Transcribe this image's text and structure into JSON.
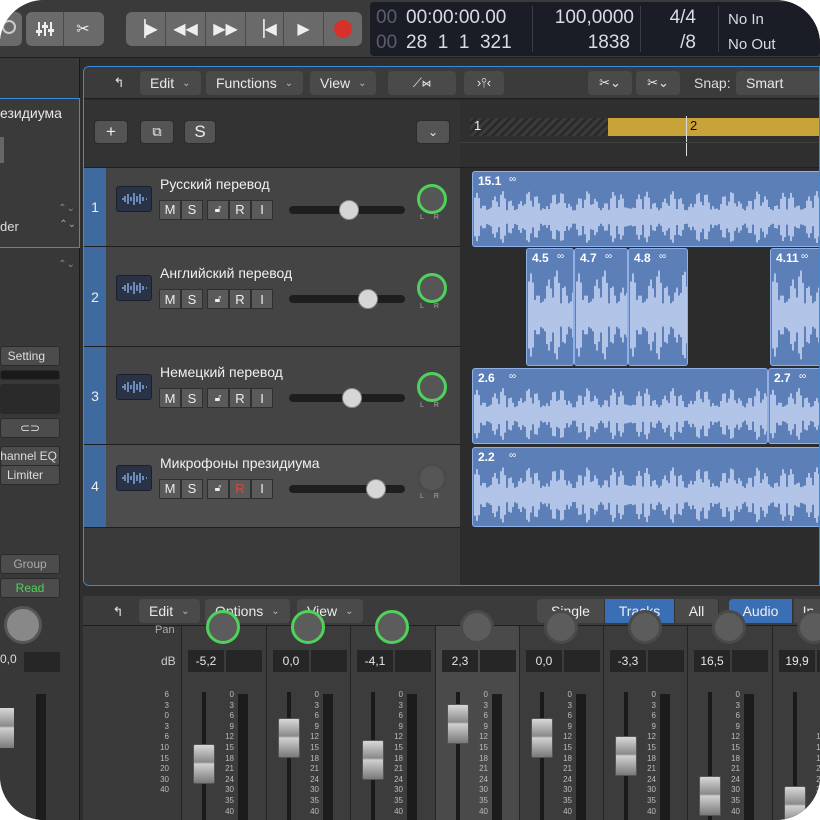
{
  "colors": {
    "accent": "#3a8bd8",
    "region": "#5c7fb8",
    "yellow": "#c7a33a",
    "record": "#d6312b",
    "green": "#4fd25b"
  },
  "transport": {
    "icons": [
      "play-from-start-icon",
      "rewind-icon",
      "fast-forward-icon",
      "go-to-start-icon",
      "play-icon",
      "record-icon"
    ],
    "time": "00:00:00.00",
    "time_prefix": "00",
    "bars": "28  1  1  321",
    "bars_prefix": "00",
    "tempo": "100,0000",
    "tempo2": "1838",
    "sig_top": "4/4",
    "sig_bottom": "/8",
    "in": "No In",
    "out": "No Out"
  },
  "inspector": {
    "title": "езидиума",
    "row1": "der",
    "setting": "Setting",
    "plugin1": "hannel EQ",
    "plugin2": "Limiter",
    "group": "Group",
    "automation": "Read",
    "vol": "0,0"
  },
  "tracks_window": {
    "menus": [
      {
        "label": "Edit"
      },
      {
        "label": "Functions"
      },
      {
        "label": "View"
      }
    ],
    "snap_label": "Snap:",
    "snap_value": "Smart",
    "add_label": "+",
    "solo_label": "S",
    "ruler": [
      "1",
      "2"
    ]
  },
  "tracks": [
    {
      "num": "1",
      "name": "Русский перевод",
      "m": "M",
      "s": "S",
      "r": "R",
      "i": "I",
      "volume": 0.52,
      "record_armed": false
    },
    {
      "num": "2",
      "name": "Английский перевод",
      "m": "M",
      "s": "S",
      "r": "R",
      "i": "I",
      "volume": 0.72,
      "record_armed": false
    },
    {
      "num": "3",
      "name": "Немецкий перевод",
      "m": "M",
      "s": "S",
      "r": "R",
      "i": "I",
      "volume": 0.55,
      "record_armed": false
    },
    {
      "num": "4",
      "name": "Микрофоны президиума",
      "m": "M",
      "s": "S",
      "r": "R",
      "i": "I",
      "volume": 0.8,
      "record_armed": true
    }
  ],
  "regions": [
    {
      "label": "15.1",
      "track": 0
    },
    {
      "label": "4.5",
      "track": 1
    },
    {
      "label": "4.7",
      "track": 1
    },
    {
      "label": "4.8",
      "track": 1
    },
    {
      "label": "4.11",
      "track": 1
    },
    {
      "label": "2.6",
      "track": 2
    },
    {
      "label": "2.7",
      "track": 2
    },
    {
      "label": "2.2",
      "track": 3
    }
  ],
  "mixer_bar": {
    "edit": "Edit",
    "options": "Options",
    "view": "View",
    "single": "Single",
    "tracks": "Tracks",
    "all": "All",
    "audio": "Audio",
    "in": "In"
  },
  "mixer": {
    "db_label": "dB",
    "pan_label": "Pan",
    "values": [
      "-5,2",
      "0,0",
      "-4,1",
      "2,3",
      "0,0",
      "-3,3",
      "16,5",
      "19,9"
    ],
    "scale": [
      "6",
      "3",
      "0",
      "3",
      "6",
      "10",
      "15",
      "20",
      "30",
      "40"
    ],
    "meter_scale": [
      "0",
      "3",
      "6",
      "9",
      "12",
      "15",
      "18",
      "21",
      "24",
      "30",
      "35",
      "40"
    ]
  }
}
